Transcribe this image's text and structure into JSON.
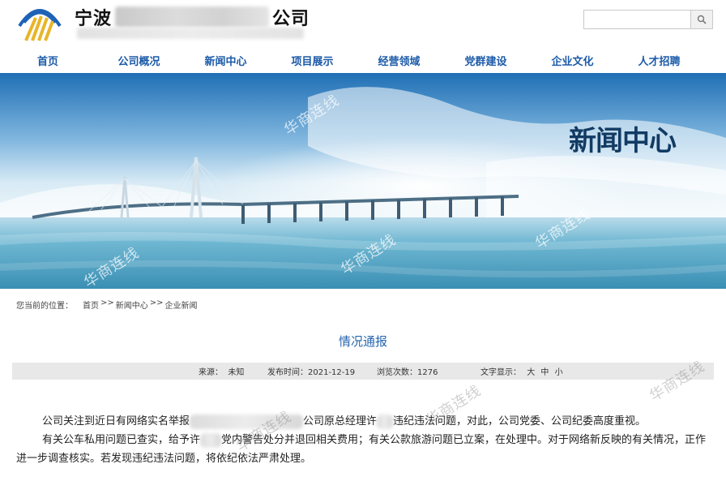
{
  "header": {
    "company_name_start": "宁波",
    "company_name_end": "公司",
    "search_placeholder": ""
  },
  "nav": {
    "items": [
      {
        "label": "首页"
      },
      {
        "label": "公司概况"
      },
      {
        "label": "新闻中心"
      },
      {
        "label": "项目展示"
      },
      {
        "label": "经营领域"
      },
      {
        "label": "党群建设"
      },
      {
        "label": "企业文化"
      },
      {
        "label": "人才招聘"
      }
    ]
  },
  "banner": {
    "title": "新闻中心",
    "watermark": "华商连线"
  },
  "breadcrumb": {
    "prefix": "您当前的位置：",
    "items": [
      {
        "label": "首页"
      },
      {
        "label": "新闻中心"
      },
      {
        "label": "企业新闻"
      }
    ],
    "separator": ">>"
  },
  "article": {
    "title": "情况通报",
    "source_label": "来源：",
    "source_value": "未知",
    "date_label": "发布时间：",
    "date_value": "2021-12-19",
    "views_label": "浏览次数：",
    "views_value": "1276",
    "font_label": "文字显示：",
    "font_large": "大",
    "font_medium": "中",
    "font_small": "小",
    "p1_a": "公司关注到近日有网络实名举报",
    "p1_b": "公司原总经理许",
    "p1_c": "违纪违法问题，对此，公司党委、公司纪委高度重视。",
    "p2_a": "有关公车私用问题已查实，给予许",
    "p2_b": "党内警告处分并退回相关费用；有关公款旅游问题已立案，在处理中。对于网络新反映的有关情况，正作进一步调查核实。若发现违纪违法问题，将依纪依法严肃处理。"
  },
  "colors": {
    "nav_text": "#1b5aa8",
    "article_title": "#2767ae",
    "banner_title": "#123b63",
    "meta_bar_bg": "#e8e8e8"
  },
  "icons": {
    "search": "magnifier-icon",
    "logo": "company-logo"
  }
}
